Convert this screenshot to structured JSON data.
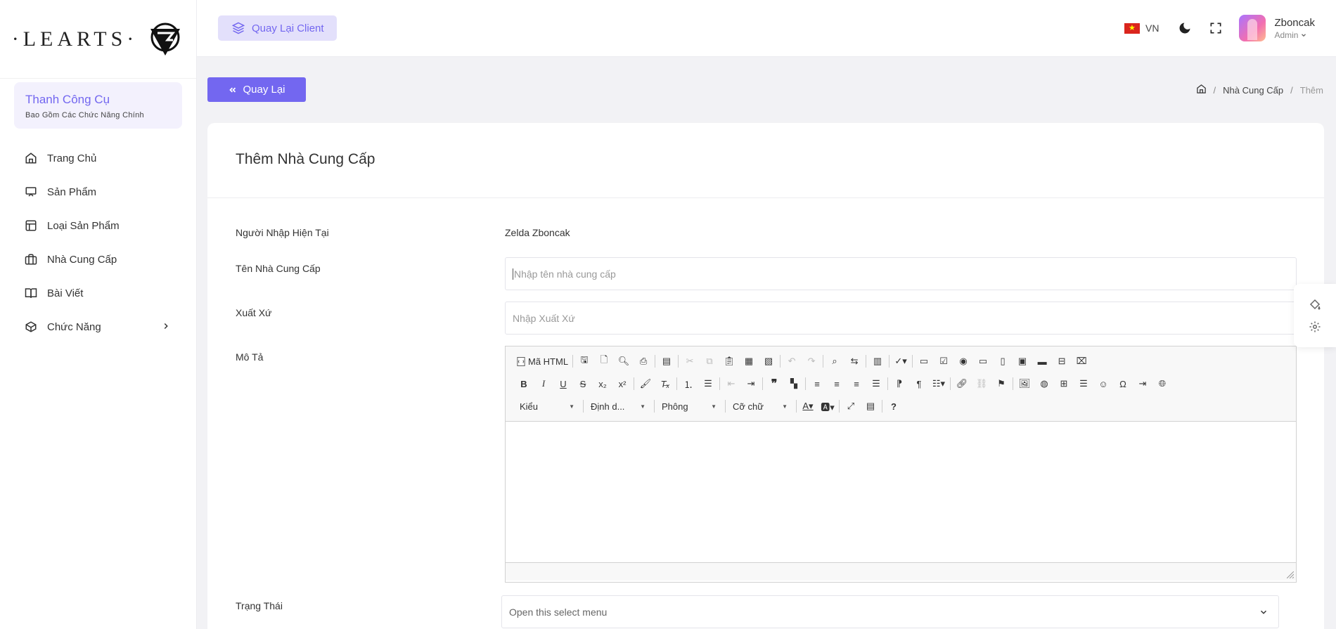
{
  "brand": {
    "logo_text": "·LEARTS·"
  },
  "sidebar": {
    "tool_box": {
      "title": "Thanh Công Cụ",
      "subtitle": "Bao Gồm Các Chức Năng Chính"
    },
    "items": [
      {
        "label": "Trang Chủ",
        "icon": "home-icon"
      },
      {
        "label": "Sản Phẩm",
        "icon": "monitor-icon"
      },
      {
        "label": "Loại Sản Phẩm",
        "icon": "layout-icon"
      },
      {
        "label": "Nhà Cung Cấp",
        "icon": "briefcase-icon"
      },
      {
        "label": "Bài Viết",
        "icon": "book-icon"
      },
      {
        "label": "Chức Năng",
        "icon": "box-icon",
        "has_children": true
      }
    ]
  },
  "topbar": {
    "client_button": "Quay Lại Client",
    "language": "VN",
    "user": {
      "name": "Zboncak",
      "role": "Admin"
    }
  },
  "actions": {
    "back_button": "Quay Lại"
  },
  "breadcrumb": {
    "items": [
      "Nhà Cung Cấp",
      "Thêm"
    ]
  },
  "form": {
    "title": "Thêm Nhà Cung Cấp",
    "current_user": {
      "label": "Người Nhập Hiện Tại",
      "value": "Zelda Zboncak"
    },
    "supplier_name": {
      "label": "Tên Nhà Cung Cấp",
      "placeholder": "Nhập tên nhà cung cấp"
    },
    "origin": {
      "label": "Xuất Xứ",
      "placeholder": "Nhập Xuất Xứ"
    },
    "description": {
      "label": "Mô Tả",
      "source_button": "Mã HTML",
      "combos": [
        "Kiểu",
        "Định d...",
        "Phông",
        "Cỡ chữ"
      ]
    },
    "status": {
      "label": "Trạng Thái",
      "placeholder": "Open this select menu"
    }
  },
  "colors": {
    "accent": "#7367f0",
    "accent_light": "#e3e0fb"
  }
}
